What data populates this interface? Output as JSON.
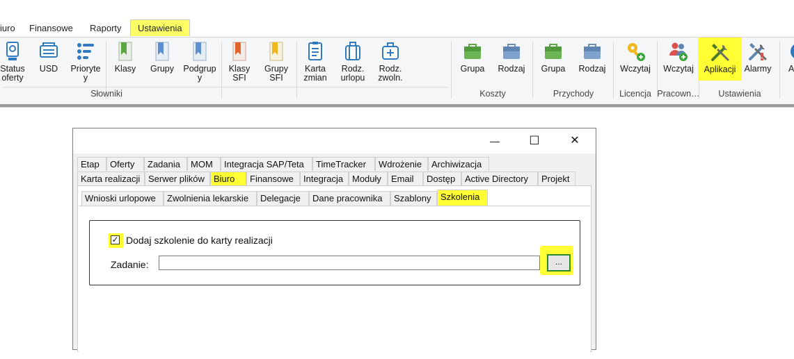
{
  "ribbon_tabs": [
    "iuro",
    "Finansowe",
    "Raporty",
    "Ustawienia"
  ],
  "ribbon": {
    "slowniki": {
      "label": "Słowniki",
      "buttons": [
        {
          "label": "Status\noferty",
          "icon": "status-offer-icon"
        },
        {
          "label": "USD",
          "icon": "usd-icon"
        },
        {
          "label": "Prioryte\ny",
          "icon": "priority-icon"
        },
        {
          "label": "Klasy",
          "icon": "class-bookmark-icon"
        },
        {
          "label": "Grupy",
          "icon": "group-bookmark-icon"
        },
        {
          "label": "Podgrup\ny",
          "icon": "subgroup-bookmark-icon"
        },
        {
          "label": "Klasy\nSFI",
          "icon": "sfi-class-bookmark-icon"
        },
        {
          "label": "Grupy\nSFI",
          "icon": "sfi-group-bookmark-icon"
        },
        {
          "label": "Karta\nzmian",
          "icon": "change-card-icon"
        },
        {
          "label": "Rodz.\nurlopu",
          "icon": "leave-type-icon"
        },
        {
          "label": "Rodz.\nzwoln.",
          "icon": "sick-leave-type-icon"
        }
      ]
    },
    "koszty": {
      "label": "Koszty",
      "buttons": [
        {
          "label": "Grupa",
          "icon": "cost-group-bag-icon"
        },
        {
          "label": "Rodzaj",
          "icon": "cost-type-bag-icon"
        }
      ]
    },
    "przychody": {
      "label": "Przychody",
      "buttons": [
        {
          "label": "Grupa",
          "icon": "income-group-bag-icon"
        },
        {
          "label": "Rodzaj",
          "icon": "income-type-bag-icon"
        }
      ]
    },
    "licencja": {
      "label": "Licencja",
      "buttons": [
        {
          "label": "Wczytaj",
          "icon": "license-key-icon"
        }
      ]
    },
    "pracownicy": {
      "label": "Pracown…",
      "buttons": [
        {
          "label": "Wczytaj",
          "icon": "employees-add-icon"
        }
      ]
    },
    "ustawienia": {
      "label": "Ustawienia",
      "buttons": [
        {
          "label": "Aplikacji",
          "icon": "tools-icon"
        },
        {
          "label": "Alarmy",
          "icon": "alarm-tools-icon"
        }
      ]
    },
    "extra": {
      "label": "A",
      "icon": "globe-icon"
    }
  },
  "dialog": {
    "controls": {
      "minimize": "—",
      "maximize": "☐",
      "close": "✕"
    },
    "tabs_row1": [
      "Etap",
      "Oferty",
      "Zadania",
      "MOM",
      "Integracja SAP/Teta",
      "TimeTracker",
      "Wdrożenie",
      "Archiwizacja"
    ],
    "tabs_row2": [
      "Karta realizacji",
      "Serwer plików",
      "Biuro",
      "Finansowe",
      "Integracja",
      "Moduły",
      "Email",
      "Dostęp",
      "Active Directory",
      "Projekt"
    ],
    "subtabs": [
      "Wnioski urlopowe",
      "Zwolnienia lekarskie",
      "Delegacje",
      "Dane pracownika",
      "Szablony",
      "Szkolenia"
    ],
    "checkbox_label": "Dodaj szkolenie do karty realizacji",
    "checkbox_checked": true,
    "checkbox_mark": "✓",
    "task_label": "Zadanie:",
    "task_value": "",
    "browse_label": "..."
  },
  "colors": {
    "highlight": "#ffff33",
    "accent_green": "#2b8a2b"
  }
}
